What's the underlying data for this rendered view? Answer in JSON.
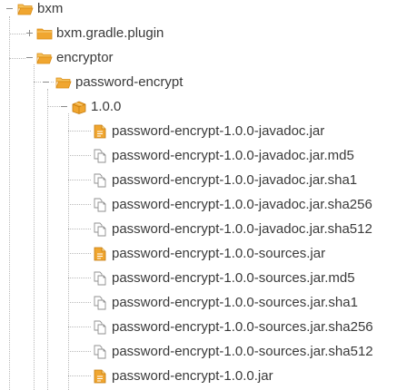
{
  "tree": {
    "root": {
      "label": "bxm",
      "icon": "folder-open-icon",
      "expanded": true
    },
    "plugin": {
      "label": "bxm.gradle.plugin",
      "icon": "folder-closed-icon",
      "expanded": false
    },
    "encryptor": {
      "label": "encryptor",
      "icon": "folder-open-icon",
      "expanded": true
    },
    "artifact": {
      "label": "password-encrypt",
      "icon": "folder-open-icon",
      "expanded": true
    },
    "version": {
      "label": "1.0.0",
      "icon": "package-icon",
      "expanded": true
    },
    "files": [
      {
        "label": "password-encrypt-1.0.0-javadoc.jar",
        "icon": "jar-file-icon"
      },
      {
        "label": "password-encrypt-1.0.0-javadoc.jar.md5",
        "icon": "copy-file-icon"
      },
      {
        "label": "password-encrypt-1.0.0-javadoc.jar.sha1",
        "icon": "copy-file-icon"
      },
      {
        "label": "password-encrypt-1.0.0-javadoc.jar.sha256",
        "icon": "copy-file-icon"
      },
      {
        "label": "password-encrypt-1.0.0-javadoc.jar.sha512",
        "icon": "copy-file-icon"
      },
      {
        "label": "password-encrypt-1.0.0-sources.jar",
        "icon": "jar-file-icon"
      },
      {
        "label": "password-encrypt-1.0.0-sources.jar.md5",
        "icon": "copy-file-icon"
      },
      {
        "label": "password-encrypt-1.0.0-sources.jar.sha1",
        "icon": "copy-file-icon"
      },
      {
        "label": "password-encrypt-1.0.0-sources.jar.sha256",
        "icon": "copy-file-icon"
      },
      {
        "label": "password-encrypt-1.0.0-sources.jar.sha512",
        "icon": "copy-file-icon"
      },
      {
        "label": "password-encrypt-1.0.0.jar",
        "icon": "jar-file-icon"
      }
    ]
  },
  "colors": {
    "folder": "#f0a630",
    "folder_dark": "#d98b12",
    "text": "#3a3a3a",
    "connector": "#b9b9b9"
  }
}
